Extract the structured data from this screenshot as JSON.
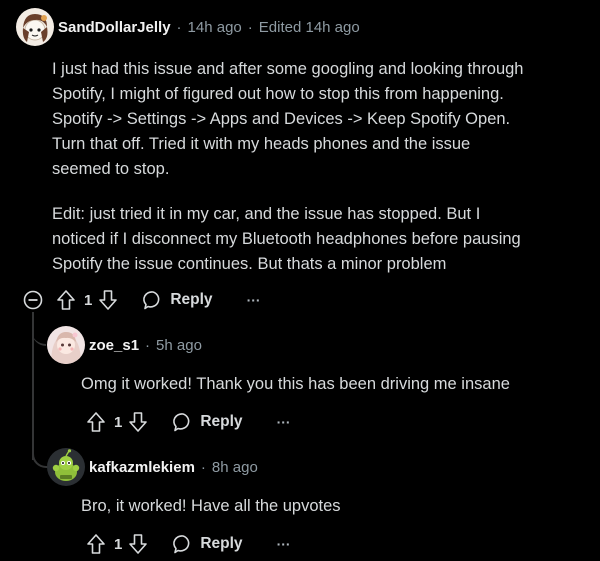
{
  "comments": [
    {
      "username": "SandDollarJelly",
      "separator": "·",
      "time": "14h ago",
      "separator2": "·",
      "edited": "Edited 14h ago",
      "body": [
        "I just had this issue and after some googling and looking through",
        "Spotify, I might of figured out how to stop this from happening.",
        "Spotify -> Settings -> Apps and Devices -> Keep Spotify Open.",
        "Turn that off. Tried it with my heads phones and the issue",
        "seemed to stop."
      ],
      "body_edit": [
        "Edit: just tried it in my car, and the issue has stopped. But I",
        "noticed if I disconnect my Bluetooth headphones before pausing",
        "Spotify the issue continues. But thats a minor problem"
      ],
      "votes": "1",
      "reply_label": "Reply",
      "more": "···"
    },
    {
      "username": "zoe_s1",
      "separator": "·",
      "time": "5h ago",
      "body": "Omg it worked! Thank you this has been driving me insane",
      "votes": "1",
      "reply_label": "Reply",
      "more": "···"
    },
    {
      "username": "kafkazmlekiem",
      "separator": "·",
      "time": "8h ago",
      "body": "Bro, it worked! Have all the upvotes",
      "votes": "1",
      "reply_label": "Reply",
      "more": "···"
    }
  ],
  "colors": {
    "background": "#000000",
    "text": "#d7dadc",
    "meta": "#8f9ba3",
    "thread_line": "#343536"
  },
  "icons": [
    "avatar-sanddollarjelly",
    "avatar-zoe",
    "avatar-kafkazmlekiem",
    "collapse-icon",
    "upvote-icon",
    "downvote-icon",
    "reply-icon",
    "more-icon"
  ]
}
